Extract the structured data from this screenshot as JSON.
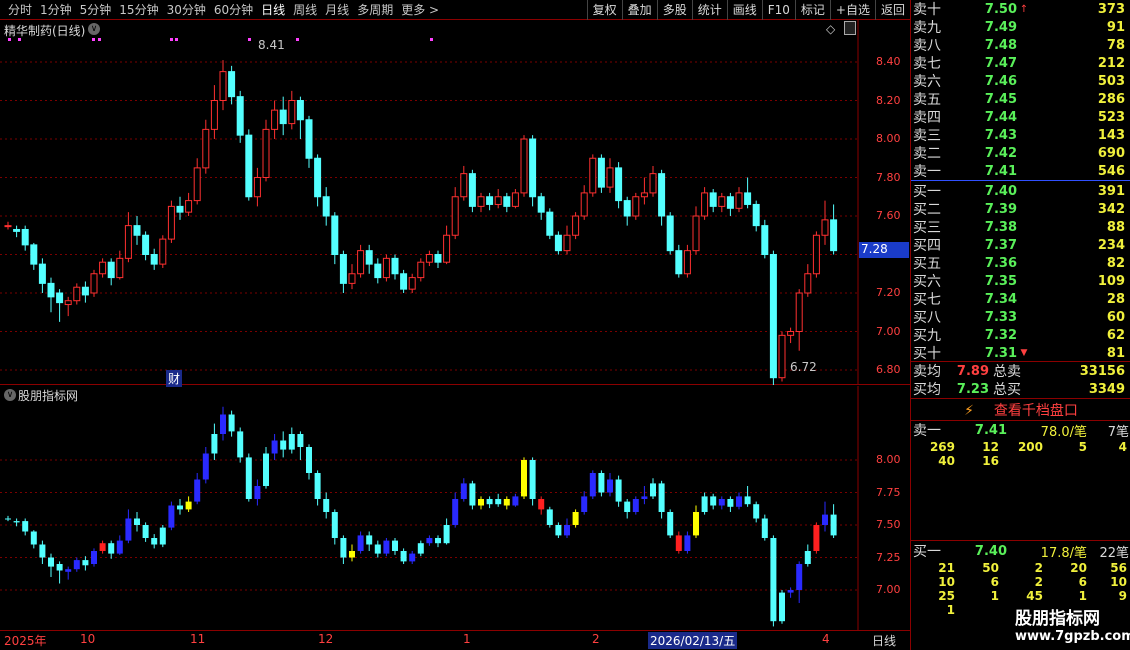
{
  "topbar": {
    "tabs": [
      "分时",
      "1分钟",
      "5分钟",
      "15分钟",
      "30分钟",
      "60分钟",
      "日线",
      "周线",
      "月线",
      "多周期",
      "更多 >"
    ],
    "active_tab": "日线",
    "buttons": [
      "复权",
      "叠加",
      "多股",
      "统计",
      "画线",
      "F10",
      "标记",
      "+自选",
      "返回"
    ]
  },
  "main_panel": {
    "title": "精华制药(日线)",
    "price_axis": [
      "8.40",
      "8.20",
      "8.00",
      "7.80",
      "7.60",
      "7.40",
      "7.20",
      "7.00",
      "6.80"
    ],
    "current_price": "7.28",
    "high_label": "8.41",
    "low_label": "6.72",
    "cai_label": "财",
    "colors": {
      "up": "#ff3030",
      "down": "#54ffff",
      "grid": "#8b0000",
      "accent": "#3050ff"
    }
  },
  "sub_panel": {
    "title": "股朋指标网",
    "axis": [
      "8.00",
      "7.75",
      "7.50",
      "7.25",
      "7.00"
    ]
  },
  "date_bar": {
    "labels": [
      "2025年",
      "10",
      "11",
      "12",
      "1",
      "2",
      "2026/02/13/五",
      "4"
    ],
    "right_label": "日线"
  },
  "order_book": {
    "asks": [
      {
        "label": "卖十",
        "price": "7.50",
        "vol": "373",
        "mark": "↑"
      },
      {
        "label": "卖九",
        "price": "7.49",
        "vol": "91"
      },
      {
        "label": "卖八",
        "price": "7.48",
        "vol": "78"
      },
      {
        "label": "卖七",
        "price": "7.47",
        "vol": "212"
      },
      {
        "label": "卖六",
        "price": "7.46",
        "vol": "503"
      },
      {
        "label": "卖五",
        "price": "7.45",
        "vol": "286"
      },
      {
        "label": "卖四",
        "price": "7.44",
        "vol": "523"
      },
      {
        "label": "卖三",
        "price": "7.43",
        "vol": "143"
      },
      {
        "label": "卖二",
        "price": "7.42",
        "vol": "690"
      },
      {
        "label": "卖一",
        "price": "7.41",
        "vol": "546"
      }
    ],
    "bids": [
      {
        "label": "买一",
        "price": "7.40",
        "vol": "391"
      },
      {
        "label": "买二",
        "price": "7.39",
        "vol": "342"
      },
      {
        "label": "买三",
        "price": "7.38",
        "vol": "88"
      },
      {
        "label": "买四",
        "price": "7.37",
        "vol": "234"
      },
      {
        "label": "买五",
        "price": "7.36",
        "vol": "82"
      },
      {
        "label": "买六",
        "price": "7.35",
        "vol": "109"
      },
      {
        "label": "买七",
        "price": "7.34",
        "vol": "28"
      },
      {
        "label": "买八",
        "price": "7.33",
        "vol": "60"
      },
      {
        "label": "买九",
        "price": "7.32",
        "vol": "62"
      },
      {
        "label": "买十",
        "price": "7.31",
        "vol": "81",
        "mark": "▼"
      }
    ],
    "summary": [
      {
        "label": "卖均",
        "price": "7.89",
        "name": "总卖",
        "value": "33156"
      },
      {
        "label": "买均",
        "price": "7.23",
        "name": "总买",
        "value": "3349"
      }
    ],
    "deep_link": "查看千档盘口",
    "sell1": {
      "label": "卖一",
      "price": "7.41",
      "avg": "78.0/笔",
      "count": "7笔",
      "vols": [
        "269",
        "12",
        "200",
        "5",
        "4",
        "40",
        "16"
      ]
    },
    "buy1": {
      "label": "买一",
      "price": "7.40",
      "avg": "17.8/笔",
      "count": "22笔",
      "vols": [
        "21",
        "50",
        "2",
        "20",
        "56",
        "10",
        "6",
        "2",
        "6",
        "10",
        "25",
        "1",
        "45",
        "1",
        "9",
        "1"
      ]
    }
  },
  "watermark": {
    "line1": "股朋指标网",
    "line2": "www.7gpzb.com"
  }
}
